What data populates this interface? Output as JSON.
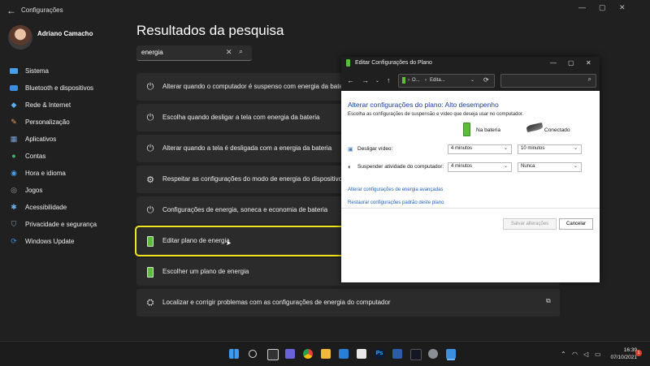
{
  "window": {
    "title": "Configurações",
    "controls": [
      "minimize-icon",
      "maximize-icon",
      "close-icon"
    ]
  },
  "user": {
    "name": "Adriano Camacho"
  },
  "sidebar": {
    "items": [
      {
        "label": "Sistema",
        "icon": "monitor-icon",
        "color": "#4aa0e8"
      },
      {
        "label": "Bluetooth e dispositivos",
        "icon": "bluetooth-icon",
        "color": "#3a8fe0"
      },
      {
        "label": "Rede & Internet",
        "icon": "wifi-icon",
        "color": "#5ab0ef"
      },
      {
        "label": "Personalização",
        "icon": "brush-icon",
        "color": "#e8a060"
      },
      {
        "label": "Aplicativos",
        "icon": "apps-icon",
        "color": "#7aa6d8"
      },
      {
        "label": "Contas",
        "icon": "person-icon",
        "color": "#45b37a"
      },
      {
        "label": "Hora e idioma",
        "icon": "globe-clock-icon",
        "color": "#4aa0e8"
      },
      {
        "label": "Jogos",
        "icon": "gamepad-icon",
        "color": "#9aa0a8"
      },
      {
        "label": "Acessibilidade",
        "icon": "accessibility-icon",
        "color": "#6fb0e8"
      },
      {
        "label": "Privacidade e segurança",
        "icon": "shield-icon",
        "color": "#8a96a8"
      },
      {
        "label": "Windows Update",
        "icon": "update-icon",
        "color": "#3a8fe0"
      }
    ]
  },
  "main": {
    "title": "Resultados da pesquisa",
    "search": {
      "value": "energia"
    },
    "results": [
      {
        "label": "Alterar quando o computador é suspenso com energia da bateria",
        "icon": "power-icon"
      },
      {
        "label": "Escolha quando desligar a tela com energia da bateria",
        "icon": "power-icon"
      },
      {
        "label": "Alterar quando a tela é desligada com a energia da bateria",
        "icon": "power-icon"
      },
      {
        "label": "Respeitar as configurações do modo de energia do dispositivo",
        "icon": "device-settings-icon"
      },
      {
        "label": "Configurações de energia, soneca e economia de bateria",
        "icon": "power-icon"
      },
      {
        "label": "Editar plano de energia",
        "icon": "battery-icon"
      },
      {
        "label": "Escolher um plano de energia",
        "icon": "battery-icon"
      },
      {
        "label": "Localizar e corrigir problemas com as configurações de energia do computador",
        "icon": "troubleshoot-icon"
      }
    ]
  },
  "dialog": {
    "title": "Editar Configurações do Plano",
    "address": {
      "part1": "O...",
      "part2": "Edita..."
    },
    "heading": "Alterar configurações do plano: Alto desempenho",
    "subtitle": "Escolha as configurações de suspensão e vídeo que deseja usar no computador.",
    "col_battery": "Na bateria",
    "col_plugged": "Conectado",
    "rows": [
      {
        "label": "Desligar vídeo:",
        "battery": "4 minutos",
        "plugged": "10 minutos"
      },
      {
        "label": "Suspender atividade do computador:",
        "battery": "4 minutos",
        "plugged": "Nunca"
      }
    ],
    "links": [
      "Alterar configurações de energia avançadas",
      "Restaurar configurações padrão deste plano"
    ],
    "save_label": "Salvar alterações",
    "cancel_label": "Cancelar"
  },
  "taskbar": {
    "icons": [
      "windows-start-icon",
      "search-icon",
      "task-view-icon",
      "teams-icon",
      "chrome-icon",
      "file-explorer-icon",
      "mail-icon",
      "calendar-icon",
      "photoshop-icon",
      "word-icon",
      "tradingview-icon",
      "settings-icon",
      "remote-desktop-icon"
    ],
    "ps_text": "Ps",
    "time": "16:39",
    "date": "07/10/2021",
    "notifications": "1"
  }
}
